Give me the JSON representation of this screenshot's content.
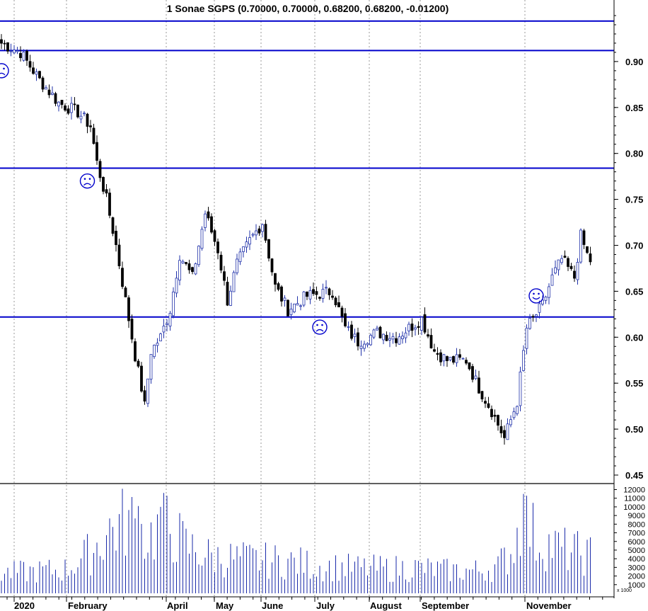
{
  "chart_data": {
    "type": "candlestick",
    "title": "1 Sonae SGPS (0.70000, 0.70000, 0.68200, 0.68200, -0.01200)",
    "price_axis": {
      "ylim": [
        0.45,
        0.95
      ],
      "ticks": [
        0.45,
        0.5,
        0.55,
        0.6,
        0.65,
        0.7,
        0.75,
        0.8,
        0.85,
        0.9
      ],
      "tick_labels": [
        "0.45",
        "0.50",
        "0.55",
        "0.60",
        "0.65",
        "0.70",
        "0.75",
        "0.80",
        "0.85",
        "0.90"
      ],
      "side": "right"
    },
    "volume_axis": {
      "ylim": [
        0,
        12000
      ],
      "ticks": [
        1000,
        2000,
        3000,
        4000,
        5000,
        6000,
        7000,
        8000,
        9000,
        10000,
        11000,
        12000
      ],
      "tick_labels": [
        "1000",
        "2000",
        "3000",
        "4000",
        "5000",
        "6000",
        "7000",
        "8000",
        "9000",
        "10000",
        "11000",
        "12000"
      ],
      "unit_label": "x 1000"
    },
    "months": [
      "2020",
      "February",
      "April",
      "May",
      "June",
      "July",
      "August",
      "September",
      "November"
    ],
    "horizontal_lines": [
      0.944,
      0.912,
      0.784,
      0.622
    ],
    "markers": [
      {
        "type": "frown",
        "x_day": 0,
        "y": 0.89
      },
      {
        "type": "frown",
        "x_day": 27,
        "y": 0.77
      },
      {
        "type": "frown",
        "x_day": 100,
        "y": 0.611
      },
      {
        "type": "smile",
        "x_day": 168,
        "y": 0.645
      }
    ],
    "close_anchors": [
      [
        0,
        0.92
      ],
      [
        6,
        0.91
      ],
      [
        12,
        0.88
      ],
      [
        18,
        0.855
      ],
      [
        24,
        0.845
      ],
      [
        28,
        0.83
      ],
      [
        30,
        0.79
      ],
      [
        33,
        0.75
      ],
      [
        36,
        0.7
      ],
      [
        39,
        0.64
      ],
      [
        42,
        0.58
      ],
      [
        44,
        0.545
      ],
      [
        45,
        0.525
      ],
      [
        47,
        0.585
      ],
      [
        50,
        0.6
      ],
      [
        53,
        0.63
      ],
      [
        56,
        0.69
      ],
      [
        60,
        0.665
      ],
      [
        64,
        0.735
      ],
      [
        68,
        0.695
      ],
      [
        71,
        0.64
      ],
      [
        74,
        0.68
      ],
      [
        78,
        0.705
      ],
      [
        82,
        0.725
      ],
      [
        86,
        0.655
      ],
      [
        90,
        0.63
      ],
      [
        96,
        0.645
      ],
      [
        104,
        0.65
      ],
      [
        108,
        0.61
      ],
      [
        112,
        0.595
      ],
      [
        118,
        0.605
      ],
      [
        124,
        0.6
      ],
      [
        132,
        0.62
      ],
      [
        136,
        0.585
      ],
      [
        140,
        0.575
      ],
      [
        146,
        0.575
      ],
      [
        150,
        0.545
      ],
      [
        154,
        0.52
      ],
      [
        158,
        0.49
      ],
      [
        162,
        0.53
      ],
      [
        165,
        0.61
      ],
      [
        168,
        0.625
      ],
      [
        170,
        0.635
      ],
      [
        173,
        0.665
      ],
      [
        176,
        0.685
      ],
      [
        180,
        0.665
      ],
      [
        182,
        0.71
      ],
      [
        184,
        0.69
      ]
    ],
    "volume_profile": [
      [
        0,
        2200
      ],
      [
        20,
        2600
      ],
      [
        28,
        4500
      ],
      [
        34,
        7000
      ],
      [
        40,
        8000
      ],
      [
        46,
        6200
      ],
      [
        52,
        7500
      ],
      [
        58,
        5200
      ],
      [
        66,
        4000
      ],
      [
        74,
        3800
      ],
      [
        82,
        3600
      ],
      [
        90,
        3500
      ],
      [
        100,
        3000
      ],
      [
        110,
        2800
      ],
      [
        120,
        2700
      ],
      [
        130,
        2800
      ],
      [
        140,
        2500
      ],
      [
        150,
        2500
      ],
      [
        156,
        3000
      ],
      [
        160,
        4500
      ],
      [
        164,
        8500
      ],
      [
        168,
        6000
      ],
      [
        176,
        4800
      ],
      [
        184,
        4200
      ]
    ],
    "last_close": 0.682,
    "grid": "vertical dotted at month starts"
  }
}
